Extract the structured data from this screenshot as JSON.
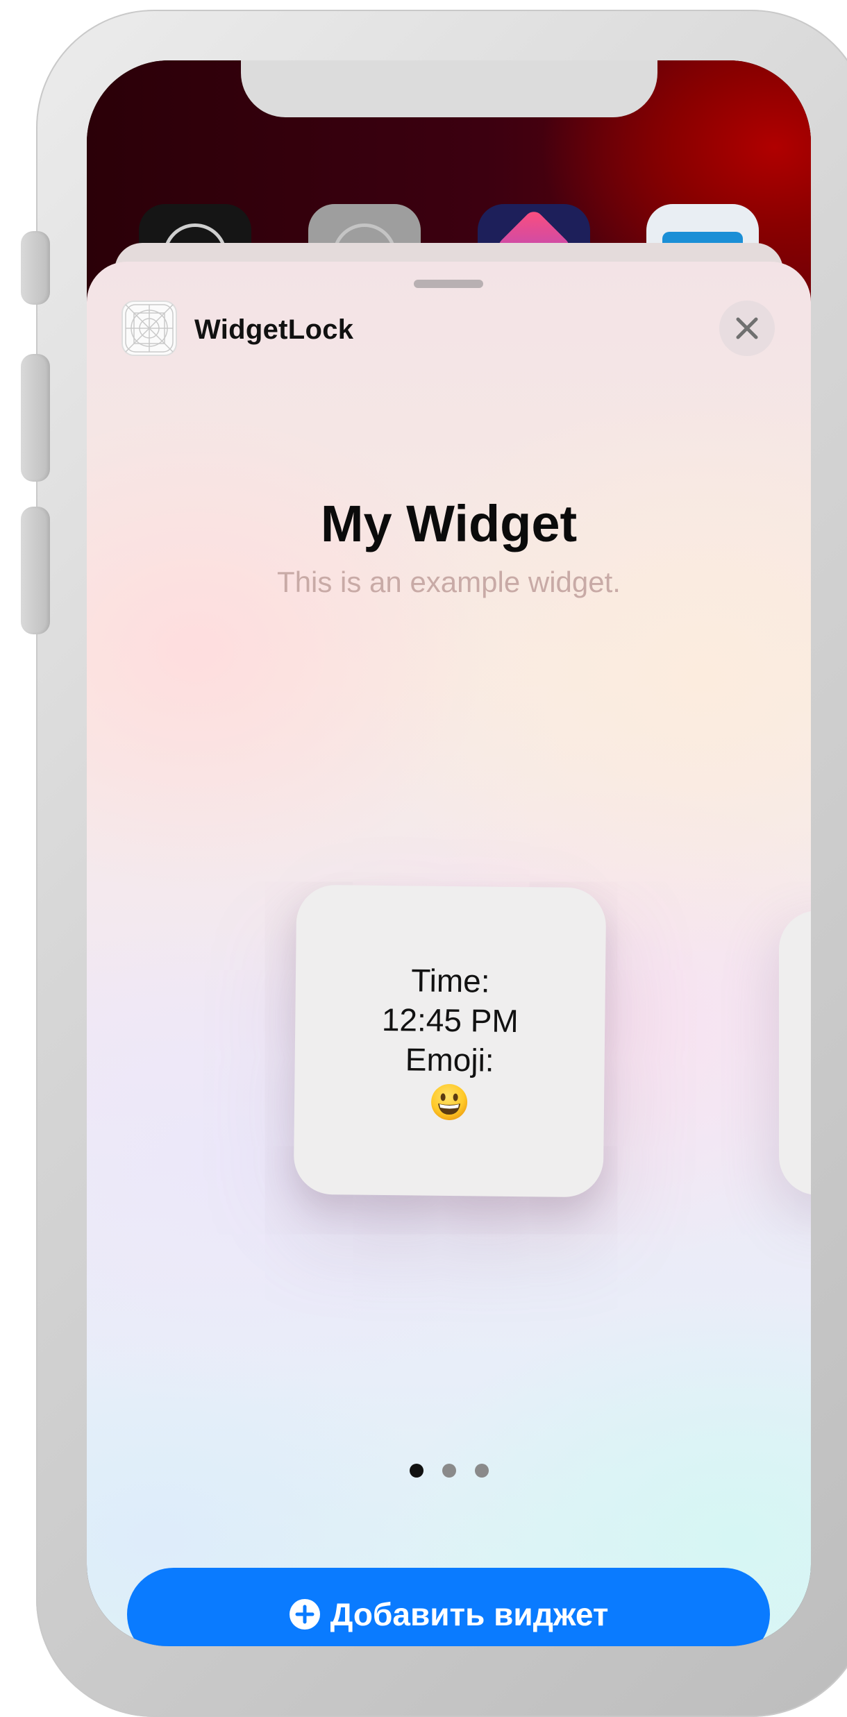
{
  "sheet": {
    "app_name": "WidgetLock",
    "title": "My Widget",
    "subtitle": "This is an example widget.",
    "close_icon": "close-icon",
    "app_icon": "app-placeholder-icon"
  },
  "widget": {
    "time_label": "Time:",
    "time_value": "12:45 PM",
    "emoji_label": "Emoji:",
    "emoji_icon": "grinning-face-emoji"
  },
  "pagination": {
    "total": 3,
    "current": 1
  },
  "add_button": {
    "label": "Добавить виджет",
    "icon": "plus-circle-icon",
    "color": "#0A7BFF"
  },
  "colors": {
    "accent": "#0A7BFF",
    "wallpaper_red": "#9A0000"
  }
}
